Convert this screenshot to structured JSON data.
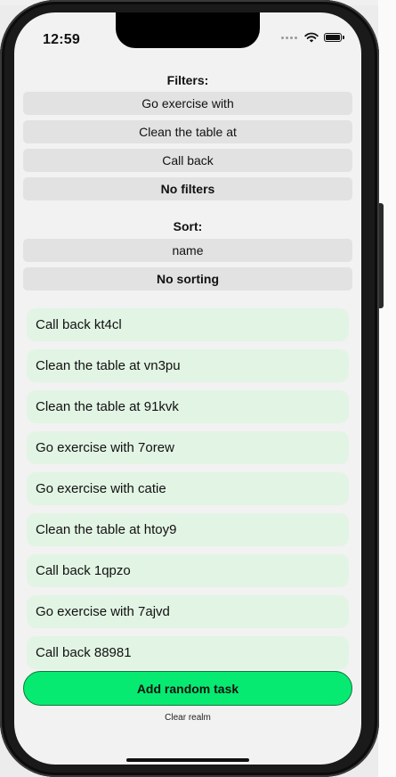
{
  "status_bar": {
    "time": "12:59"
  },
  "filters": {
    "title": "Filters:",
    "options": [
      "Go exercise with",
      "Clean the table at",
      "Call back"
    ],
    "clear_label": "No filters"
  },
  "sort": {
    "title": "Sort:",
    "options": [
      "name"
    ],
    "clear_label": "No sorting"
  },
  "tasks": [
    "Call back kt4cl",
    "Clean the table at vn3pu",
    "Clean the table at 91kvk",
    "Go exercise with 7orew",
    "Go exercise with catie",
    "Clean the table at htoy9",
    "Call back 1qpzo",
    "Go exercise with 7ajvd",
    "Call back 88981"
  ],
  "actions": {
    "add_label": "Add random task",
    "clear_label": "Clear realm"
  },
  "colors": {
    "add_button": "#07ea71",
    "task_background": "#e2f4e4",
    "pill_background": "#e2e2e2"
  }
}
